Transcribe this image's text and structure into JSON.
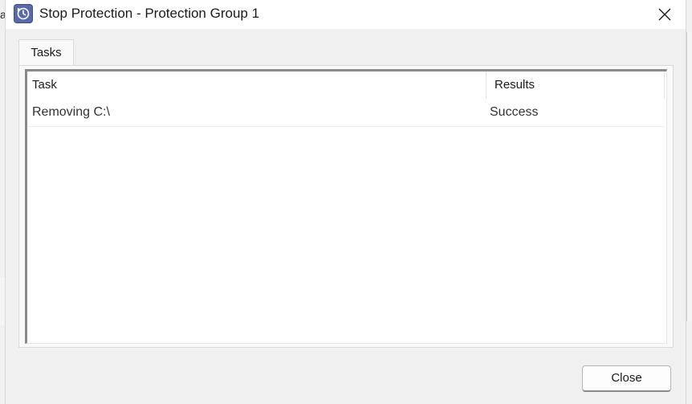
{
  "window": {
    "title": "Stop Protection - Protection Group 1",
    "icon": "protection-clock-icon",
    "close_icon": "close-icon"
  },
  "background_window": {
    "partial_letter": "a"
  },
  "tabs": [
    {
      "label": "Tasks",
      "selected": true
    }
  ],
  "task_list": {
    "columns": [
      "Task",
      "Results"
    ],
    "rows": [
      {
        "task": "Removing C:\\",
        "result": "Success"
      }
    ]
  },
  "buttons": {
    "close_label": "Close"
  },
  "colors": {
    "app_icon": "#5a6aa8",
    "window_bg": "#f0f0f0",
    "panel_bg": "#f9f9f9"
  }
}
